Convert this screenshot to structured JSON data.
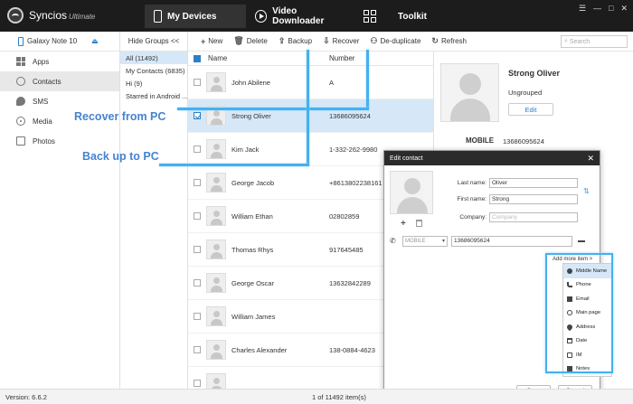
{
  "app": {
    "name": "Syncios",
    "edition": "Ultimate"
  },
  "nav": {
    "tabs": [
      {
        "label": "My Devices"
      },
      {
        "label": "Video Downloader"
      },
      {
        "label": "Toolkit"
      }
    ]
  },
  "window_controls": {
    "menu": "☰",
    "minimize": "—",
    "maximize": "□",
    "close": "✕"
  },
  "device": {
    "name": "Galaxy Note 10",
    "eject": "⏏"
  },
  "sidebar": {
    "items": [
      {
        "label": "Apps",
        "icon": "apps-icon"
      },
      {
        "label": "Contacts",
        "icon": "contacts-icon"
      },
      {
        "label": "SMS",
        "icon": "sms-icon"
      },
      {
        "label": "Media",
        "icon": "media-icon"
      },
      {
        "label": "Photos",
        "icon": "photos-icon"
      }
    ]
  },
  "groups": {
    "header": "Hide Groups <<",
    "items": [
      "All (11492)",
      "My Contacts (6835)",
      "Hi (9)",
      "Starred in Android ..."
    ]
  },
  "toolbar": {
    "new": "New",
    "delete": "Delete",
    "backup": "Backup",
    "recover": "Recover",
    "deduplicate": "De-duplicate",
    "refresh": "Refresh",
    "search_placeholder": "Search"
  },
  "list": {
    "columns": {
      "name": "Name",
      "number": "Number"
    },
    "rows": [
      {
        "name": "John Abilene",
        "number": "A"
      },
      {
        "name": "Strong Oliver",
        "number": "13686095624"
      },
      {
        "name": "Kim Jack",
        "number": "1-332-262-9980"
      },
      {
        "name": "George Jacob",
        "number": "+8613802238161"
      },
      {
        "name": "William Ethan",
        "number": "02802859"
      },
      {
        "name": "Thomas Rhys",
        "number": "917645485"
      },
      {
        "name": "George Oscar",
        "number": "13632842289"
      },
      {
        "name": "William James",
        "number": ""
      },
      {
        "name": "Charles Alexander",
        "number": "138-0884-4623"
      },
      {
        "name": "",
        "number": ""
      }
    ]
  },
  "details": {
    "name": "Strong Oliver",
    "group": "Ungrouped",
    "edit": "Edit",
    "phone_label": "MOBILE",
    "phone": "13686095624"
  },
  "callouts": {
    "recover": "Recover from PC",
    "backup": "Back up to PC"
  },
  "dialog": {
    "title": "Edit contact",
    "close": "✕",
    "add": "+",
    "last_name_label": "Last name:",
    "last_name": "Oliver",
    "first_name_label": "First name:",
    "first_name": "Strong",
    "company_label": "Company:",
    "company_placeholder": "Company",
    "phone_type": "MOBILE",
    "phone": "13686095624",
    "add_more": "Add more item >",
    "save": "Save",
    "cancel": "Cancel"
  },
  "more_items": [
    "Middle Name",
    "Phone",
    "Email",
    "Main page",
    "Address",
    "Date",
    "IM",
    "Notes"
  ],
  "status": {
    "version": "Version: 6.6.2",
    "count": "1 of 11492 item(s)"
  }
}
